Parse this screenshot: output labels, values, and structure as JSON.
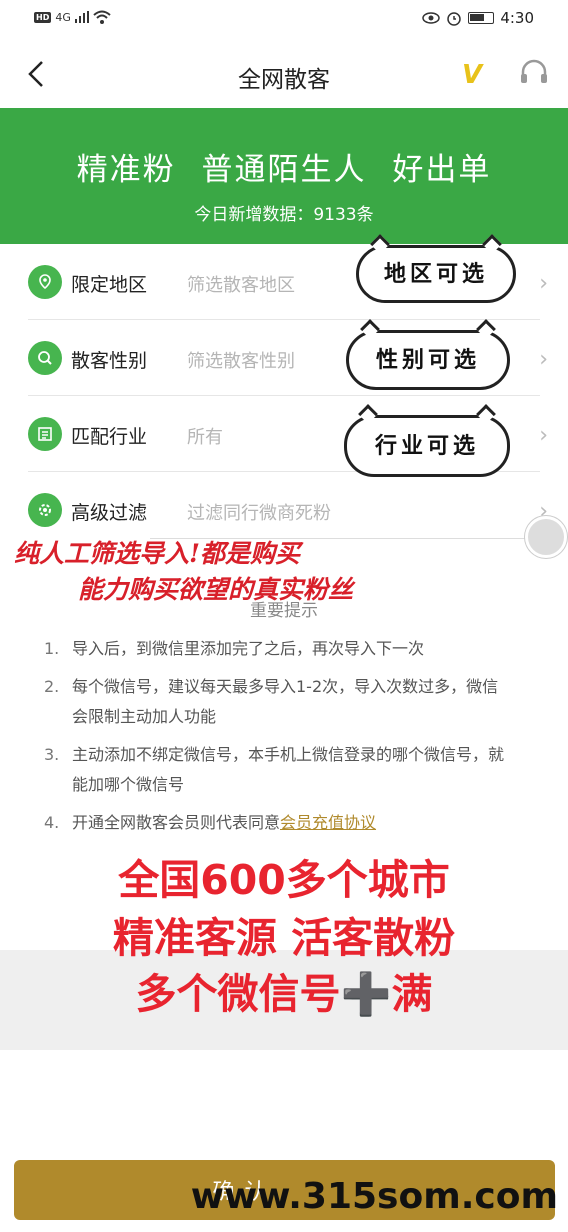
{
  "status_bar": {
    "hd": "HD",
    "network": "4G",
    "time": "4:30"
  },
  "nav": {
    "title": "全网散客",
    "vip_label": "V"
  },
  "banner": {
    "headline": "精准粉 普通陌生人 好出单",
    "subline": "今日新增数据：9133条"
  },
  "filters": [
    {
      "label": "限定地区",
      "value": "筛选散客地区",
      "icon": "location-icon"
    },
    {
      "label": "散客性别",
      "value": "筛选散客性别",
      "icon": "search-icon"
    },
    {
      "label": "匹配行业",
      "value": "所有",
      "icon": "list-icon"
    },
    {
      "label": "高级过滤",
      "value": "过滤同行微商死粉",
      "icon": "gear-icon"
    }
  ],
  "bubbles": {
    "region": "地区可选",
    "gender": "性别可选",
    "industry": "行业可选"
  },
  "overlay_text": {
    "line1": "纯人工筛选导入!都是购买",
    "line2": "能力购买欲望的真实粉丝"
  },
  "notice": {
    "title": "重要提示",
    "items": [
      {
        "num": "1.",
        "text": "导入后，到微信里添加完了之后，再次导入下一次"
      },
      {
        "num": "2.",
        "text": "每个微信号，建议每天最多导入1-2次，导入次数过多，微信会限制主动加人功能"
      },
      {
        "num": "3.",
        "text": "主动添加不绑定微信号，本手机上微信登录的哪个微信号，就能加哪个微信号"
      },
      {
        "num": "4.",
        "text": "开通全网散客会员则代表同意",
        "link": "会员充值协议"
      }
    ]
  },
  "promo": {
    "line1": "全国600多个城市",
    "line2": "精准客源 活客散粉",
    "line3": "多个微信号➕满"
  },
  "confirm_label": "确认",
  "watermark": "www.315som.com",
  "colors": {
    "green": "#3aa845",
    "gold": "#b08a2c",
    "red": "#e8242f"
  }
}
